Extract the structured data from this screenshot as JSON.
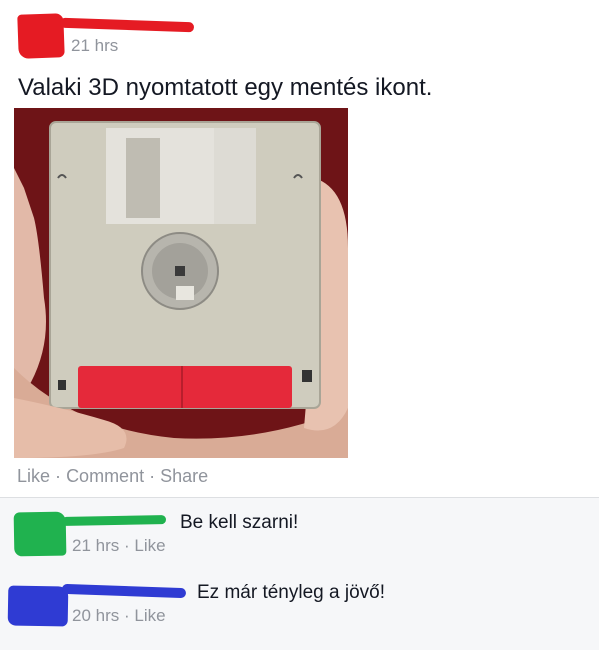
{
  "post": {
    "time": "21 hrs",
    "text": "Valaki 3D nyomtatott egy mentés ikont.",
    "actions": {
      "like": "Like",
      "comment": "Comment",
      "share": "Share",
      "separator": "·"
    }
  },
  "comments": [
    {
      "text": "Be kell szarni!",
      "time": "21 hrs",
      "like": "Like",
      "separator": "·"
    },
    {
      "text": "Ez már tényleg a jövő!",
      "time": "20 hrs",
      "like": "Like",
      "separator": "·"
    }
  ],
  "colors": {
    "redact_red": "#e51b23",
    "redact_green": "#20b24f",
    "redact_blue": "#2f3bd3",
    "meta_gray": "#90949c"
  }
}
